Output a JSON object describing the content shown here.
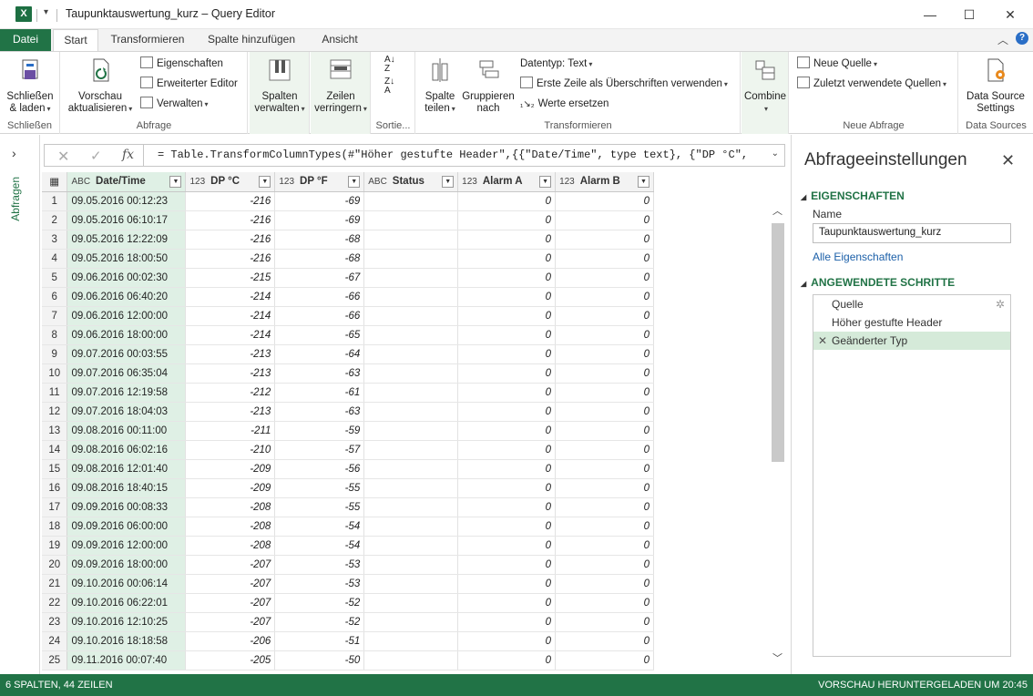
{
  "window": {
    "title": "Taupunktauswertung_kurz – Query Editor",
    "app_icon": "X",
    "minimize": "—",
    "maximize": "☐",
    "close": "✕"
  },
  "tabs": [
    "Datei",
    "Start",
    "Transformieren",
    "Spalte hinzufügen",
    "Ansicht"
  ],
  "ribbon": {
    "groups": {
      "schliessen": "Schließen",
      "abfrage": "Abfrage",
      "sortieren": "Sortie...",
      "transformieren": "Transformieren",
      "neue_abfrage": "Neue Abfrage",
      "data_sources": "Data Sources"
    },
    "schliessen_btn_1": "Schließen",
    "schliessen_btn_2": "& laden",
    "vorschau_1": "Vorschau",
    "vorschau_2": "aktualisieren",
    "eigenschaften": "Eigenschaften",
    "erweiterter_editor": "Erweiterter Editor",
    "verwalten": "Verwalten",
    "spalten_1": "Spalten",
    "spalten_2": "verwalten",
    "zeilen_1": "Zeilen",
    "zeilen_2": "verringern",
    "spalte_teilen_1": "Spalte",
    "spalte_teilen_2": "teilen",
    "gruppieren_1": "Gruppieren",
    "gruppieren_2": "nach",
    "datentyp": "Datentyp: Text",
    "erste_zeile": "Erste Zeile als Überschriften verwenden",
    "werte_ersetzen": "Werte ersetzen",
    "combine": "Combine",
    "neue_quelle": "Neue Quelle",
    "zuletzt": "Zuletzt verwendete Quellen",
    "ds_settings_1": "Data Source",
    "ds_settings_2": "Settings"
  },
  "sidebar": {
    "label": "Abfragen"
  },
  "formula": "= Table.TransformColumnTypes(#\"Höher gestufte Header\",{{\"Date/Time\", type text}, {\"DP °C\",",
  "columns": [
    {
      "type": "ABC",
      "name": "Date/Time"
    },
    {
      "type": "123",
      "name": "DP °C"
    },
    {
      "type": "123",
      "name": "DP °F"
    },
    {
      "type": "ABC",
      "name": "Status"
    },
    {
      "type": "123",
      "name": "Alarm A"
    },
    {
      "type": "123",
      "name": "Alarm B"
    }
  ],
  "rows": [
    [
      "1",
      "09.05.2016 00:12:23",
      "-216",
      "-69",
      "",
      "0",
      "0"
    ],
    [
      "2",
      "09.05.2016 06:10:17",
      "-216",
      "-69",
      "",
      "0",
      "0"
    ],
    [
      "3",
      "09.05.2016 12:22:09",
      "-216",
      "-68",
      "",
      "0",
      "0"
    ],
    [
      "4",
      "09.05.2016 18:00:50",
      "-216",
      "-68",
      "",
      "0",
      "0"
    ],
    [
      "5",
      "09.06.2016 00:02:30",
      "-215",
      "-67",
      "",
      "0",
      "0"
    ],
    [
      "6",
      "09.06.2016 06:40:20",
      "-214",
      "-66",
      "",
      "0",
      "0"
    ],
    [
      "7",
      "09.06.2016 12:00:00",
      "-214",
      "-66",
      "",
      "0",
      "0"
    ],
    [
      "8",
      "09.06.2016 18:00:00",
      "-214",
      "-65",
      "",
      "0",
      "0"
    ],
    [
      "9",
      "09.07.2016 00:03:55",
      "-213",
      "-64",
      "",
      "0",
      "0"
    ],
    [
      "10",
      "09.07.2016 06:35:04",
      "-213",
      "-63",
      "",
      "0",
      "0"
    ],
    [
      "11",
      "09.07.2016 12:19:58",
      "-212",
      "-61",
      "",
      "0",
      "0"
    ],
    [
      "12",
      "09.07.2016 18:04:03",
      "-213",
      "-63",
      "",
      "0",
      "0"
    ],
    [
      "13",
      "09.08.2016 00:11:00",
      "-211",
      "-59",
      "",
      "0",
      "0"
    ],
    [
      "14",
      "09.08.2016 06:02:16",
      "-210",
      "-57",
      "",
      "0",
      "0"
    ],
    [
      "15",
      "09.08.2016 12:01:40",
      "-209",
      "-56",
      "",
      "0",
      "0"
    ],
    [
      "16",
      "09.08.2016 18:40:15",
      "-209",
      "-55",
      "",
      "0",
      "0"
    ],
    [
      "17",
      "09.09.2016 00:08:33",
      "-208",
      "-55",
      "",
      "0",
      "0"
    ],
    [
      "18",
      "09.09.2016 06:00:00",
      "-208",
      "-54",
      "",
      "0",
      "0"
    ],
    [
      "19",
      "09.09.2016 12:00:00",
      "-208",
      "-54",
      "",
      "0",
      "0"
    ],
    [
      "20",
      "09.09.2016 18:00:00",
      "-207",
      "-53",
      "",
      "0",
      "0"
    ],
    [
      "21",
      "09.10.2016 00:06:14",
      "-207",
      "-53",
      "",
      "0",
      "0"
    ],
    [
      "22",
      "09.10.2016 06:22:01",
      "-207",
      "-52",
      "",
      "0",
      "0"
    ],
    [
      "23",
      "09.10.2016 12:10:25",
      "-207",
      "-52",
      "",
      "0",
      "0"
    ],
    [
      "24",
      "09.10.2016 18:18:58",
      "-206",
      "-51",
      "",
      "0",
      "0"
    ],
    [
      "25",
      "09.11.2016 00:07:40",
      "-205",
      "-50",
      "",
      "0",
      "0"
    ]
  ],
  "settings": {
    "title": "Abfrageeinstellungen",
    "properties_header": "EIGENSCHAFTEN",
    "name_label": "Name",
    "name_value": "Taupunktauswertung_kurz",
    "all_props": "Alle Eigenschaften",
    "steps_header": "ANGEWENDETE SCHRITTE",
    "steps": [
      "Quelle",
      "Höher gestufte Header",
      "Geänderter Typ"
    ]
  },
  "statusbar": {
    "left": "6 SPALTEN, 44 ZEILEN",
    "right": "VORSCHAU HERUNTERGELADEN UM 20:45"
  },
  "colors": {
    "accent": "#217346",
    "selected_col": "#dff0e5"
  }
}
